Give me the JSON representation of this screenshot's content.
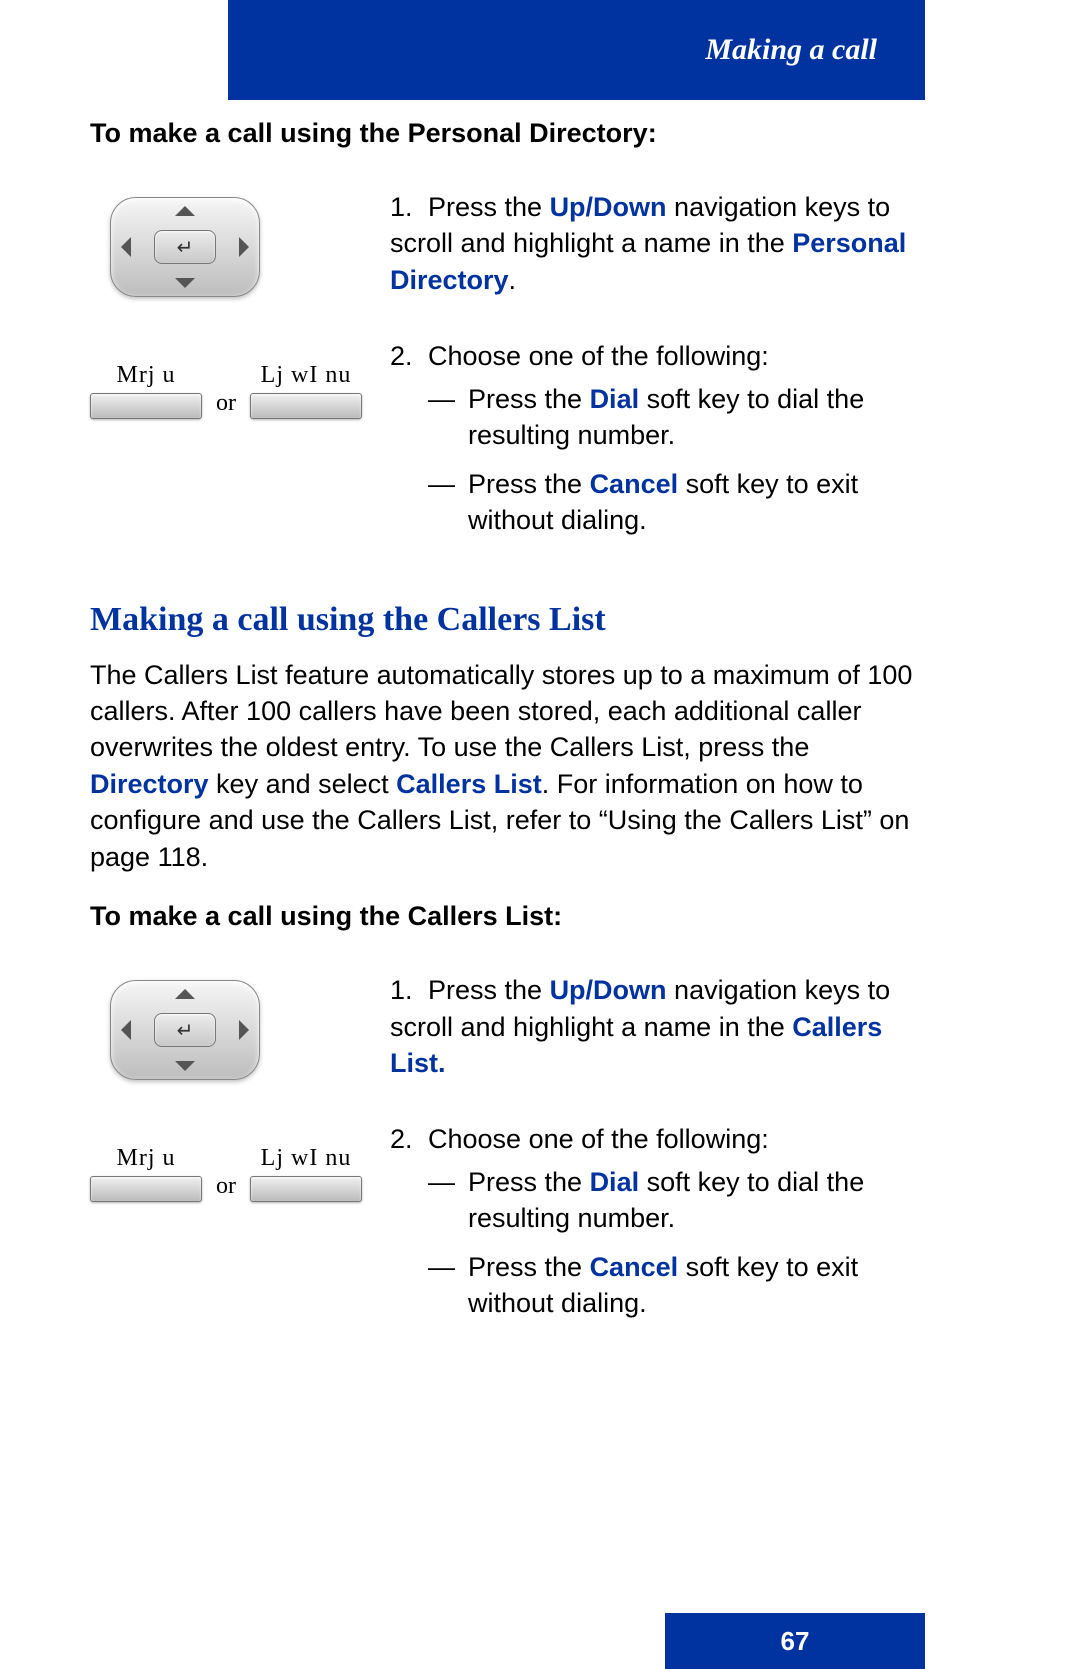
{
  "header": {
    "title": "Making a call"
  },
  "footer": {
    "page_number": "67"
  },
  "section1": {
    "intro": "To make a call using the Personal Directory:",
    "step1": {
      "num": "1.",
      "pre": "Press the ",
      "link1": "Up/Down",
      "mid": " navigation keys to scroll and highlight a name in the ",
      "link2": "Personal Directory",
      "post": "."
    },
    "step2": {
      "num": "2.",
      "lead": "Choose one of the following:",
      "opt1_pre": "Press the ",
      "opt1_link": "Dial",
      "opt1_post": " soft key to dial the resulting number.",
      "opt2_pre": "Press the ",
      "opt2_link": "Cancel",
      "opt2_post": " soft key to exit without dialing."
    },
    "softkeys": {
      "left": "Mrj u",
      "right": "Lj wI nu",
      "or": "or"
    }
  },
  "section2": {
    "heading": "Making a call using the Callers List",
    "para_pre": "The Callers List feature automatically stores up to a maximum of 100 callers. After 100 callers have been stored, each additional caller overwrites the oldest entry. To use the Callers List, press the ",
    "para_link1": "Directory",
    "para_mid": " key and select ",
    "para_link2": "Callers List",
    "para_post": ". For information on how to configure and use the Callers List, refer to “Using the Callers List” on page 118.",
    "intro": "To make a call using the Callers List:",
    "step1": {
      "num": "1.",
      "pre": "Press the ",
      "link1": "Up/Down",
      "mid": " navigation keys to scroll and highlight a name in the ",
      "link2": "Callers List.",
      "post": ""
    },
    "step2": {
      "num": "2.",
      "lead": "Choose one of the following:",
      "opt1_pre": "Press the ",
      "opt1_link": "Dial",
      "opt1_post": " soft key to dial the resulting number.",
      "opt2_pre": "Press the ",
      "opt2_link": "Cancel",
      "opt2_post": " soft key to exit without dialing."
    },
    "softkeys": {
      "left": "Mrj u",
      "right": "Lj wI nu",
      "or": "or"
    }
  },
  "nav_center_glyph": "↵"
}
